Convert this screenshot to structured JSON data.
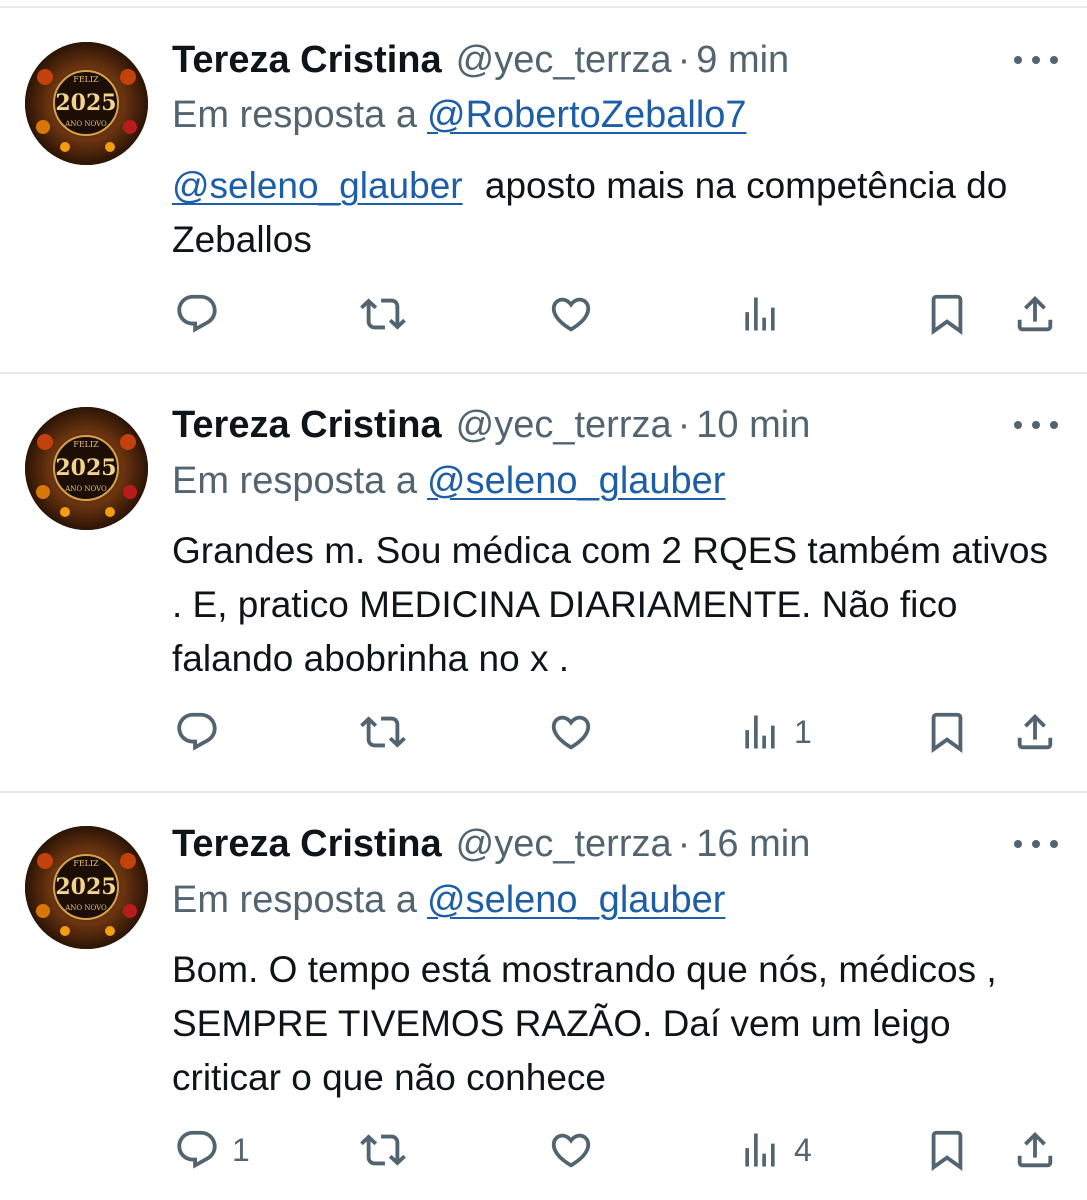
{
  "tweets": [
    {
      "display_name": "Tereza Cristina",
      "handle": "@yec_terrza",
      "separator": "·",
      "time": "9 min",
      "reply_prefix": "Em resposta a",
      "reply_to": "@RobertoZeballo7",
      "mention": "@seleno_glauber",
      "body": "aposto mais na competência do Zeballos",
      "reply_count": "",
      "views_count": ""
    },
    {
      "display_name": "Tereza Cristina",
      "handle": "@yec_terrza",
      "separator": "·",
      "time": "10 min",
      "reply_prefix": "Em resposta a",
      "reply_to": "@seleno_glauber",
      "mention": "",
      "body": "Grandes m. Sou médica com 2 RQES também ativos . E, pratico MEDICINA DIARIAMENTE. Não fico falando abobrinha no x .",
      "reply_count": "",
      "views_count": "1"
    },
    {
      "display_name": "Tereza Cristina",
      "handle": "@yec_terrza",
      "separator": "·",
      "time": "16 min",
      "reply_prefix": "Em resposta a",
      "reply_to": "@seleno_glauber",
      "mention": "",
      "body": "Bom. O tempo está mostrando que nós, médicos , SEMPRE TIVEMOS RAZÃO. Daí vem um leigo criticar o que não conhece",
      "reply_count": "1",
      "views_count": "4"
    }
  ],
  "avatar_text": {
    "top": "FELIZ",
    "year": "2025",
    "bottom": "ANO NOVO"
  },
  "colors": {
    "text": "#0f1419",
    "muted": "#536471",
    "link": "#1d5ea8",
    "divider": "#e7e9ea"
  },
  "icons": [
    "reply-icon",
    "retweet-icon",
    "like-icon",
    "views-icon",
    "bookmark-icon",
    "share-icon",
    "more-icon"
  ]
}
